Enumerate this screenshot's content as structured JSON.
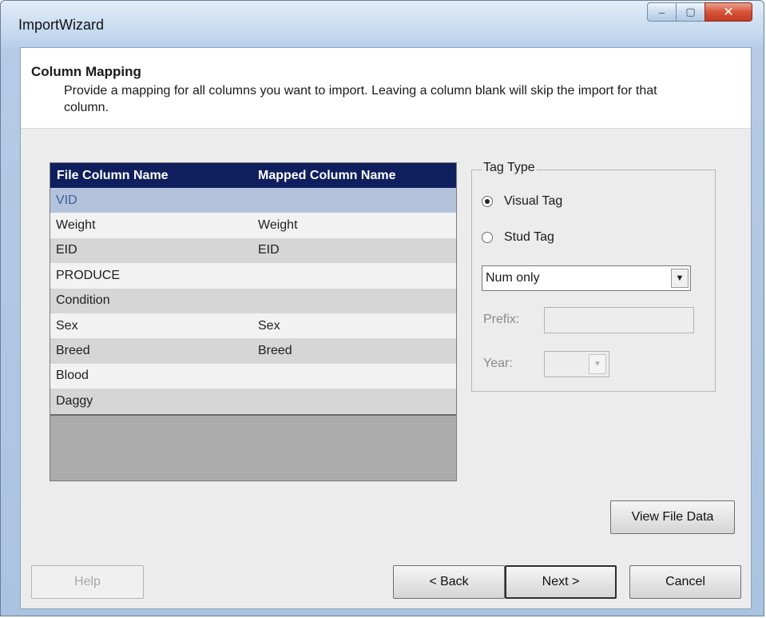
{
  "window": {
    "title": "ImportWizard",
    "minimize": "–",
    "maximize": "▢",
    "close": "✕"
  },
  "header": {
    "title": "Column Mapping",
    "description": "Provide a mapping for all columns you want to import. Leaving a column blank will skip the import for that column."
  },
  "grid": {
    "columns": [
      "File Column Name",
      "Mapped Column Name"
    ],
    "rows": [
      {
        "file": "VID",
        "mapped": ""
      },
      {
        "file": "Weight",
        "mapped": "Weight"
      },
      {
        "file": "EID",
        "mapped": "EID"
      },
      {
        "file": "PRODUCE",
        "mapped": ""
      },
      {
        "file": "Condition",
        "mapped": ""
      },
      {
        "file": "Sex",
        "mapped": "Sex"
      },
      {
        "file": "Breed",
        "mapped": "Breed"
      },
      {
        "file": "Blood",
        "mapped": ""
      },
      {
        "file": "Daggy",
        "mapped": ""
      }
    ]
  },
  "tag_type": {
    "legend": "Tag Type",
    "visual_label": "Visual Tag",
    "stud_label": "Stud Tag",
    "selected": "Visual Tag",
    "format_value": "Num only",
    "prefix_label": "Prefix:",
    "year_label": "Year:"
  },
  "buttons": {
    "view_file_data": "View File Data",
    "help": "Help",
    "back": "< Back",
    "next": "Next >",
    "cancel": "Cancel"
  }
}
